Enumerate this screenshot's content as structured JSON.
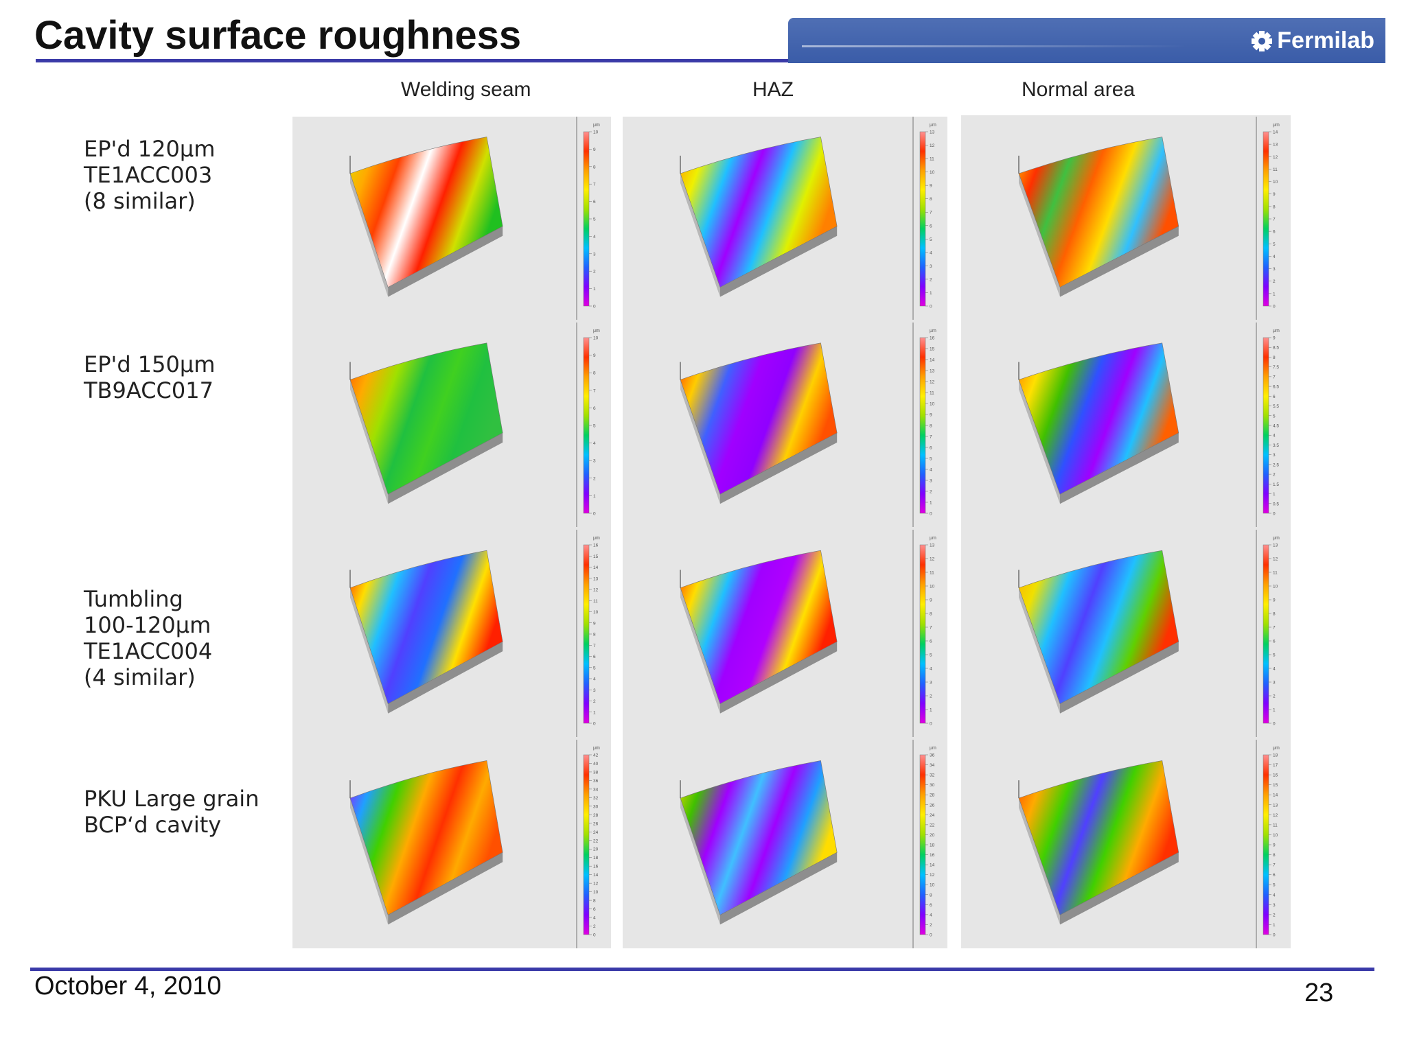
{
  "slide": {
    "title": "Cavity surface roughness",
    "brand": "Fermilab",
    "date": "October 4, 2010",
    "page_number": "23"
  },
  "columns": [
    "Welding seam",
    "HAZ",
    "Normal area"
  ],
  "rows": [
    {
      "lines": [
        "EP'd 120μm",
        "TE1ACC003",
        "(8 similar)"
      ]
    },
    {
      "lines": [
        "EP'd 150μm",
        "TB9ACC017"
      ]
    },
    {
      "lines": [
        "Tumbling",
        "100-120μm",
        "TE1ACC004",
        "(4 similar)"
      ]
    },
    {
      "lines": [
        "PKU Large grain",
        "BCP‘d cavity"
      ]
    }
  ],
  "colors": {
    "title_rule": "#3a3aa8",
    "banner": "#3a5ca8",
    "panel_background": "#e6e6e6"
  },
  "panels": [
    {
      "colorbar_unit": "μm",
      "colorbar_ticks": [
        "0",
        "1",
        "2",
        "3",
        "4",
        "5",
        "6",
        "7",
        "8",
        "9",
        "10"
      ],
      "stops": [
        "#e0e000",
        "#ffaa00",
        "#ff4000",
        "#ffffff",
        "#ff2000",
        "#d0e000",
        "#20c020"
      ],
      "extra_scale": []
    },
    {
      "colorbar_unit": "μm",
      "colorbar_ticks": [
        "0",
        "1",
        "2",
        "3",
        "4",
        "5",
        "6",
        "7",
        "8",
        "9",
        "10",
        "11",
        "12",
        "13"
      ],
      "stops": [
        "#ff9000",
        "#f0f000",
        "#20c0ff",
        "#a000ff",
        "#20c0ff",
        "#e0f000",
        "#ff8000"
      ],
      "extra_scale": []
    },
    {
      "colorbar_unit": "μm",
      "colorbar_ticks": [
        "0",
        "1",
        "2",
        "3",
        "4",
        "5",
        "6",
        "7",
        "8",
        "9",
        "10",
        "11",
        "12",
        "13",
        "14"
      ],
      "stops": [
        "#ffcc00",
        "#ff3000",
        "#40c040",
        "#ff6000",
        "#ffdd00",
        "#30c0ff",
        "#ff5000"
      ],
      "extra_scale": []
    },
    {
      "colorbar_unit": "μm",
      "colorbar_ticks": [
        "0",
        "1",
        "2",
        "3",
        "4",
        "5",
        "6",
        "7",
        "8",
        "9",
        "10"
      ],
      "stops": [
        "#ff5000",
        "#ffaa00",
        "#a0e000",
        "#20c040",
        "#40d020",
        "#20c040",
        "#30c040"
      ],
      "extra_scale": []
    },
    {
      "colorbar_unit": "μm",
      "colorbar_ticks": [
        "0",
        "1",
        "2",
        "3",
        "4",
        "5",
        "6",
        "7",
        "8",
        "9",
        "10",
        "11",
        "12",
        "13",
        "14",
        "15",
        "16"
      ],
      "stops": [
        "#ff3000",
        "#ffcc00",
        "#4060ff",
        "#a000ff",
        "#9000ff",
        "#ffd000",
        "#ff5000"
      ],
      "extra_scale": []
    },
    {
      "colorbar_unit": "μm",
      "colorbar_ticks": [
        "0",
        "0.5",
        "1",
        "1.5",
        "2",
        "2.5",
        "3",
        "3.5",
        "4",
        "4.5",
        "5",
        "5.5",
        "6",
        "6.5",
        "7",
        "7.5",
        "8",
        "8.5",
        "9"
      ],
      "stops": [
        "#ff7000",
        "#ffe000",
        "#40c000",
        "#3050ff",
        "#a000ff",
        "#20c0ff",
        "#ff6000"
      ],
      "extra_scale": []
    },
    {
      "colorbar_unit": "μm",
      "colorbar_ticks": [
        "0",
        "1",
        "2",
        "3",
        "4",
        "5",
        "6",
        "7",
        "8",
        "9",
        "10",
        "11",
        "12",
        "13",
        "14",
        "15",
        "16"
      ],
      "stops": [
        "#ff2000",
        "#ffdd00",
        "#20c0ff",
        "#5040ff",
        "#2070ff",
        "#ffe000",
        "#ff2000"
      ],
      "extra_scale": []
    },
    {
      "colorbar_unit": "μm",
      "colorbar_ticks": [
        "0",
        "1",
        "2",
        "3",
        "4",
        "5",
        "6",
        "7",
        "8",
        "9",
        "10",
        "11",
        "12",
        "13"
      ],
      "stops": [
        "#ff3000",
        "#ffdd00",
        "#20c0ff",
        "#a000ff",
        "#b000ff",
        "#ffe000",
        "#ff2000"
      ],
      "extra_scale": []
    },
    {
      "colorbar_unit": "μm",
      "colorbar_ticks": [
        "0",
        "1",
        "2",
        "3",
        "4",
        "5",
        "6",
        "7",
        "8",
        "9",
        "10",
        "11",
        "12",
        "13"
      ],
      "stops": [
        "#ffaa00",
        "#f0e000",
        "#20c0ff",
        "#5040ff",
        "#20c0ff",
        "#60d000",
        "#ff3000"
      ],
      "extra_scale": []
    },
    {
      "colorbar_unit": "μm",
      "colorbar_ticks": [
        "0",
        "2",
        "4",
        "6",
        "8",
        "10",
        "12",
        "14",
        "16",
        "18",
        "20",
        "22",
        "24",
        "26",
        "28",
        "30",
        "32",
        "34",
        "36",
        "38",
        "40",
        "42"
      ],
      "stops": [
        "#b000ff",
        "#20a0ff",
        "#40d000",
        "#ffaa00",
        "#ff3000",
        "#ffaa00",
        "#ff5000"
      ],
      "extra_scale": []
    },
    {
      "colorbar_unit": "μm",
      "colorbar_ticks": [
        "0",
        "2",
        "4",
        "6",
        "8",
        "10",
        "12",
        "14",
        "16",
        "18",
        "20",
        "22",
        "24",
        "26",
        "28",
        "30",
        "32",
        "34",
        "36"
      ],
      "stops": [
        "#ffdd00",
        "#40c000",
        "#a000ff",
        "#40c0ff",
        "#a000ff",
        "#20a0ff",
        "#ffdd00"
      ],
      "extra_scale": []
    },
    {
      "colorbar_unit": "μm",
      "colorbar_ticks": [
        "0",
        "1",
        "2",
        "3",
        "4",
        "5",
        "6",
        "7",
        "8",
        "9",
        "10",
        "11",
        "12",
        "13",
        "14",
        "15",
        "16",
        "17",
        "18"
      ],
      "stops": [
        "#ff4000",
        "#ffaa00",
        "#40d000",
        "#5040ff",
        "#40d000",
        "#ffaa00",
        "#ff3000"
      ],
      "extra_scale": []
    }
  ]
}
